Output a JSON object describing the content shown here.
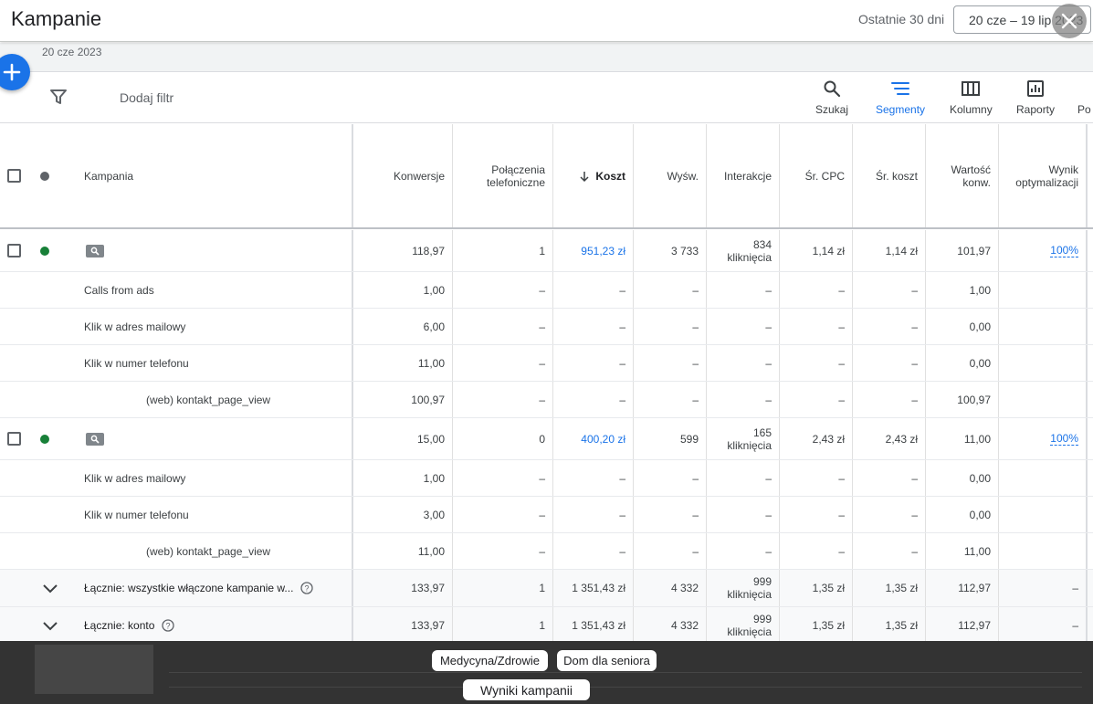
{
  "header": {
    "title": "Kampanie",
    "range_label": "Ostatnie 30 dni",
    "date_range": "20 cze – 19 lip 2023",
    "sub_date": "20 cze 2023"
  },
  "toolbar": {
    "add_filter": "Dodaj filtr",
    "tools": [
      "Szukaj",
      "Segmenty",
      "Kolumny",
      "Raporty",
      "Po"
    ]
  },
  "columns": {
    "campaign": "Kampania",
    "conversions": "Konwersje",
    "calls": "Połączenia telefoniczne",
    "cost": "Koszt",
    "impressions": "Wyśw.",
    "interactions": "Interakcje",
    "avg_cpc": "Śr. CPC",
    "avg_cost": "Śr. koszt",
    "conv_value": "Wartość konw.",
    "opt_score": "Wynik optymalizacji"
  },
  "rows": [
    {
      "kind": "campaign",
      "status_color": "#188038",
      "conversions": "118,97",
      "calls": "1",
      "cost": "951,23 zł",
      "impressions": "3 733",
      "interactions": "834 kliknięcia",
      "avg_cpc": "1,14 zł",
      "avg_cost": "1,14 zł",
      "conv_value": "101,97",
      "opt_score": "100%"
    },
    {
      "kind": "segment",
      "label": "Calls from ads",
      "conversions": "1,00",
      "calls": "–",
      "cost": "–",
      "impressions": "–",
      "interactions": "–",
      "avg_cpc": "–",
      "avg_cost": "–",
      "conv_value": "1,00",
      "opt_score": ""
    },
    {
      "kind": "segment",
      "label": "Klik w adres mailowy",
      "conversions": "6,00",
      "calls": "–",
      "cost": "–",
      "impressions": "–",
      "interactions": "–",
      "avg_cpc": "–",
      "avg_cost": "–",
      "conv_value": "0,00",
      "opt_score": ""
    },
    {
      "kind": "segment",
      "label": "Klik w numer telefonu",
      "conversions": "11,00",
      "calls": "–",
      "cost": "–",
      "impressions": "–",
      "interactions": "–",
      "avg_cpc": "–",
      "avg_cost": "–",
      "conv_value": "0,00",
      "opt_score": ""
    },
    {
      "kind": "segment-indent",
      "label": "(web) kontakt_page_view",
      "conversions": "100,97",
      "calls": "–",
      "cost": "–",
      "impressions": "–",
      "interactions": "–",
      "avg_cpc": "–",
      "avg_cost": "–",
      "conv_value": "100,97",
      "opt_score": ""
    },
    {
      "kind": "campaign",
      "status_color": "#188038",
      "conversions": "15,00",
      "calls": "0",
      "cost": "400,20 zł",
      "impressions": "599",
      "interactions": "165 kliknięcia",
      "avg_cpc": "2,43 zł",
      "avg_cost": "2,43 zł",
      "conv_value": "11,00",
      "opt_score": "100%"
    },
    {
      "kind": "segment",
      "label": "Klik w adres mailowy",
      "conversions": "1,00",
      "calls": "–",
      "cost": "–",
      "impressions": "–",
      "interactions": "–",
      "avg_cpc": "–",
      "avg_cost": "–",
      "conv_value": "0,00",
      "opt_score": ""
    },
    {
      "kind": "segment",
      "label": "Klik w numer telefonu",
      "conversions": "3,00",
      "calls": "–",
      "cost": "–",
      "impressions": "–",
      "interactions": "–",
      "avg_cpc": "–",
      "avg_cost": "–",
      "conv_value": "0,00",
      "opt_score": ""
    },
    {
      "kind": "segment-indent",
      "label": "(web) kontakt_page_view",
      "conversions": "11,00",
      "calls": "–",
      "cost": "–",
      "impressions": "–",
      "interactions": "–",
      "avg_cpc": "–",
      "avg_cost": "–",
      "conv_value": "11,00",
      "opt_score": ""
    },
    {
      "kind": "summary",
      "label": "Łącznie: wszystkie włączone kampanie w...",
      "conversions": "133,97",
      "calls": "1",
      "cost": "1 351,43 zł",
      "impressions": "4 332",
      "interactions": "999 kliknięcia",
      "avg_cpc": "1,35 zł",
      "avg_cost": "1,35 zł",
      "conv_value": "112,97",
      "opt_score": "–"
    },
    {
      "kind": "summary",
      "label": "Łącznie: konto",
      "conversions": "133,97",
      "calls": "1",
      "cost": "1 351,43 zł",
      "impressions": "4 332",
      "interactions": "999 kliknięcia",
      "avg_cpc": "1,35 zł",
      "avg_cost": "1,35 zł",
      "conv_value": "112,97",
      "opt_score": "–"
    }
  ],
  "overlay": {
    "chips": [
      "Medycyna/Zdrowie",
      "Dom dla seniora",
      "Wyniki kampanii"
    ]
  },
  "colors": {
    "accent": "#1a73e8",
    "status_enabled": "#188038"
  }
}
